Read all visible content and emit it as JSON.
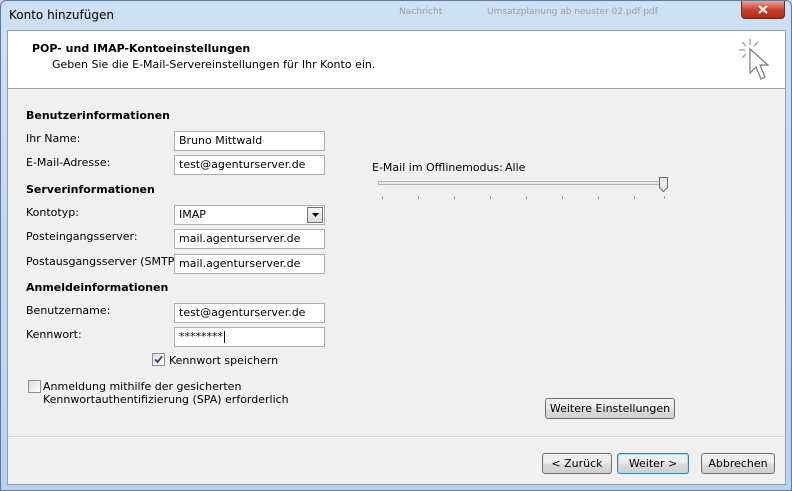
{
  "window": {
    "title": "Konto hinzufügen",
    "background_tabs": [
      "Nachricht",
      "Umsatzplanung ab neuster 02.pdf pdf"
    ]
  },
  "header": {
    "title": "POP- und IMAP-Kontoeinstellungen",
    "subtitle": "Geben Sie die E-Mail-Servereinstellungen für Ihr Konto ein.",
    "icon": "wizard-cursor-icon"
  },
  "user_info": {
    "section": "Benutzerinformationen",
    "name_label": "Ihr Name:",
    "name_value": "Bruno Mittwald",
    "email_label": "E-Mail-Adresse:",
    "email_value": "test@agenturserver.de"
  },
  "server_info": {
    "section": "Serverinformationen",
    "account_type_label": "Kontotyp:",
    "account_type_value": "IMAP",
    "incoming_label": "Posteingangsserver:",
    "incoming_value": "mail.agenturserver.de",
    "outgoing_label": "Postausgangsserver (SMTP):",
    "outgoing_value": "mail.agenturserver.de"
  },
  "login_info": {
    "section": "Anmeldeinformationen",
    "username_label": "Benutzername:",
    "username_value": "test@agenturserver.de",
    "password_label": "Kennwort:",
    "password_value": "********",
    "remember_label": "Kennwort speichern",
    "remember_checked": true,
    "spa_label_line1": "Anmeldung mithilfe der gesicherten",
    "spa_label_line2": "Kennwortauthentifizierung (SPA) erforderlich",
    "spa_checked": false
  },
  "offline": {
    "label": "E-Mail im Offlinemodus:",
    "value": "Alle",
    "slider_fraction": 1.0
  },
  "buttons": {
    "more_settings": "Weitere Einstellungen",
    "back": "< Zurück",
    "next": "Weiter >",
    "cancel": "Abbrechen"
  },
  "colors": {
    "accent": "#3c7fb1",
    "close": "#c7432f"
  }
}
